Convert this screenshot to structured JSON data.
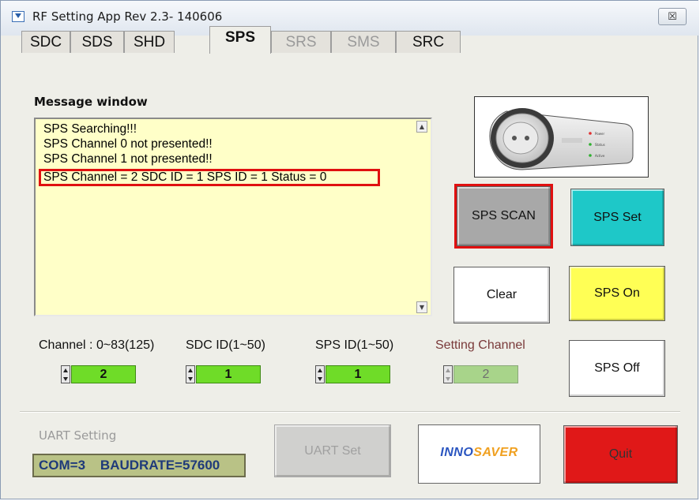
{
  "window": {
    "title": "RF Setting App Rev 2.3- 140606",
    "close_glyph": "☒"
  },
  "tabs": [
    {
      "label": "SDC",
      "state": "normal"
    },
    {
      "label": "SDS",
      "state": "normal"
    },
    {
      "label": "SHD",
      "state": "normal"
    },
    {
      "label": "SPS",
      "state": "active"
    },
    {
      "label": "SRS",
      "state": "disabled"
    },
    {
      "label": "SMS",
      "state": "disabled"
    },
    {
      "label": "SRC",
      "state": "normal"
    }
  ],
  "message_window": {
    "label": "Message window",
    "lines": [
      "SPS Searching!!!",
      "SPS Channel 0 not presented!!",
      "SPS Channel 1 not presented!!",
      "SPS Channel = 2 SDC ID = 1 SPS ID = 1 Status = 0"
    ]
  },
  "buttons": {
    "sps_scan": "SPS SCAN",
    "sps_set": "SPS Set",
    "clear": "Clear",
    "sps_on": "SPS On",
    "sps_off": "SPS Off",
    "uart_set": "UART Set",
    "quit": "Quit"
  },
  "fields": {
    "channel": {
      "label": "Channel : 0~83(125)",
      "value": "2"
    },
    "sdc_id": {
      "label": "SDC ID(1~50)",
      "value": "1"
    },
    "sps_id": {
      "label": "SPS ID(1~50)",
      "value": "1"
    },
    "setting_channel": {
      "label": "Setting Channel",
      "value": "2"
    }
  },
  "uart": {
    "label": "UART Setting",
    "status": "COM=3    BAUDRATE=57600"
  },
  "logo": {
    "part1": "INNO",
    "part2": "SAVER"
  },
  "device_labels": [
    "Power",
    "Status",
    "Active"
  ],
  "colors": {
    "scan_button": "#a8a8a8",
    "set_button": "#1ec8c8",
    "on_button": "#ffff55",
    "quit_button": "#e01818",
    "highlight": "#e01010",
    "spin_value": "#6fdc28",
    "message_bg": "#ffffc8"
  }
}
